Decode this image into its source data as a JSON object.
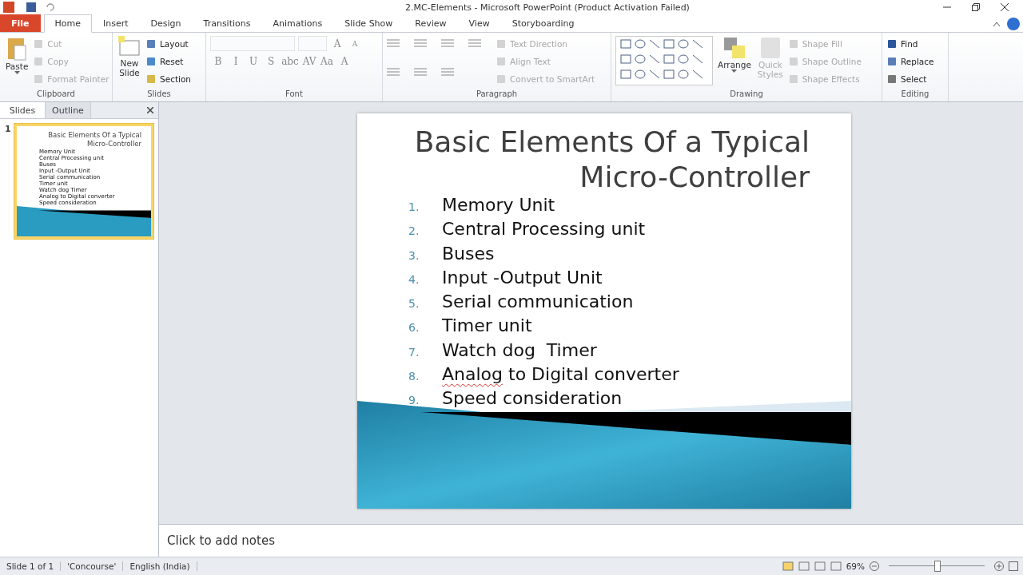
{
  "window": {
    "title": "2.MC-Elements  -  Microsoft PowerPoint (Product Activation Failed)"
  },
  "tabs": [
    {
      "label": "File",
      "kind": "file",
      "selected": false
    },
    {
      "label": "Home",
      "kind": "tab",
      "selected": true
    },
    {
      "label": "Insert",
      "kind": "tab",
      "selected": false
    },
    {
      "label": "Design",
      "kind": "tab",
      "selected": false
    },
    {
      "label": "Transitions",
      "kind": "tab",
      "selected": false
    },
    {
      "label": "Animations",
      "kind": "tab",
      "selected": false
    },
    {
      "label": "Slide Show",
      "kind": "tab",
      "selected": false
    },
    {
      "label": "Review",
      "kind": "tab",
      "selected": false
    },
    {
      "label": "View",
      "kind": "tab",
      "selected": false
    },
    {
      "label": "Storyboarding",
      "kind": "tab",
      "selected": false
    }
  ],
  "ribbon": {
    "clipboard": {
      "label": "Clipboard",
      "paste": "Paste",
      "items": [
        {
          "label": "Cut",
          "disabled": true
        },
        {
          "label": "Copy",
          "disabled": true
        },
        {
          "label": "Format Painter",
          "disabled": true
        }
      ]
    },
    "slides": {
      "label": "Slides",
      "new_slide": [
        "New",
        "Slide"
      ],
      "items": [
        {
          "label": "Layout",
          "disabled": false
        },
        {
          "label": "Reset",
          "disabled": false
        },
        {
          "label": "Section",
          "disabled": false
        }
      ]
    },
    "font": {
      "label": "Font",
      "grow": "A",
      "shrink": "A",
      "buttons": [
        "B",
        "I",
        "U",
        "S",
        "abc",
        "AV",
        "Aa",
        "A"
      ]
    },
    "paragraph": {
      "label": "Paragraph",
      "items": [
        {
          "label": "Text Direction",
          "disabled": true
        },
        {
          "label": "Align Text",
          "disabled": true
        },
        {
          "label": "Convert to SmartArt",
          "disabled": true
        }
      ]
    },
    "drawing": {
      "label": "Drawing",
      "arrange": "Arrange",
      "quick_styles": [
        "Quick",
        "Styles"
      ],
      "items": [
        {
          "label": "Shape Fill",
          "disabled": true
        },
        {
          "label": "Shape Outline",
          "disabled": true
        },
        {
          "label": "Shape Effects",
          "disabled": true
        }
      ]
    },
    "editing": {
      "label": "Editing",
      "items": [
        {
          "label": "Find",
          "disabled": false
        },
        {
          "label": "Replace",
          "disabled": false
        },
        {
          "label": "Select",
          "disabled": false
        }
      ]
    }
  },
  "panel": {
    "tabs": [
      {
        "label": "Slides",
        "selected": true
      },
      {
        "label": "Outline",
        "selected": false
      }
    ],
    "thumbnails": [
      {
        "number": "1",
        "selected": true,
        "title_lines": [
          "Basic Elements Of a Typical",
          "Micro-Controller"
        ],
        "items": [
          "Memory Unit",
          "Central Processing unit",
          "Buses",
          "Input -Output Unit",
          "Serial communication",
          "Timer unit",
          "Watch dog  Timer",
          "Analog to Digital converter",
          "Speed consideration"
        ]
      }
    ]
  },
  "slide": {
    "title_lines": [
      "Basic Elements Of a Typical",
      "Micro-Controller"
    ],
    "items": [
      {
        "number": "1.",
        "text": "Memory Unit"
      },
      {
        "number": "2.",
        "text": "Central Processing unit"
      },
      {
        "number": "3.",
        "text": "Buses"
      },
      {
        "number": "4.",
        "text": "Input -Output Unit"
      },
      {
        "number": "5.",
        "text": "Serial communication"
      },
      {
        "number": "6.",
        "text": "Timer unit"
      },
      {
        "number": "7.",
        "text": "Watch dog  Timer"
      },
      {
        "number": "8.",
        "text": "Analog to Digital converter",
        "misspelled": true
      },
      {
        "number": "9.",
        "text": "Speed consideration"
      }
    ]
  },
  "notes": {
    "placeholder": "Click to add notes"
  },
  "status_bar": {
    "items": [
      "Slide 1 of 1",
      "'Concourse'",
      "English (India)"
    ],
    "zoom": "69%",
    "level": 0.5
  }
}
